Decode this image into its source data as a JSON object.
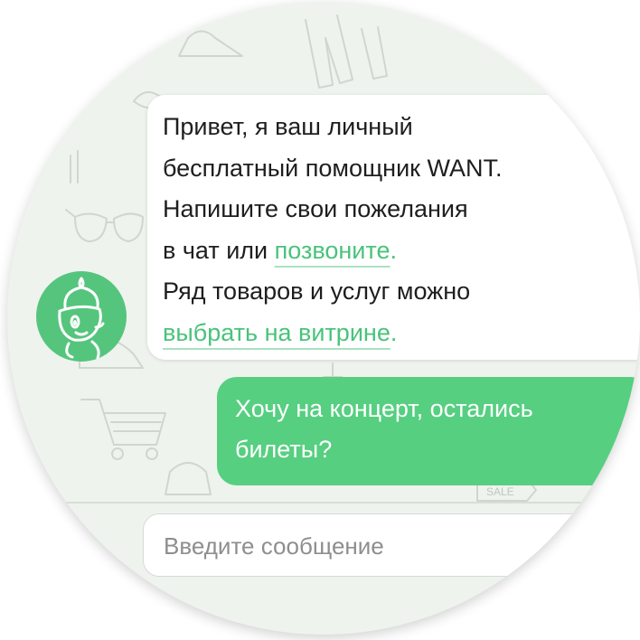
{
  "chat": {
    "bot_message": {
      "line1": "Привет, я ваш личный",
      "line2": "бесплатный помощник WANT.",
      "line3": "Напишите свои пожелания",
      "line4_prefix": "в чат или ",
      "line4_link": "позвоните",
      "line4_suffix": ".",
      "line5": "Ряд товаров и услуг можно",
      "line6_link": "выбрать на витрине",
      "line6_suffix": "."
    },
    "user_message": {
      "line1": "Хочу на концерт, остались",
      "line2": "билеты?"
    }
  },
  "input": {
    "placeholder": "Введите сообщение"
  },
  "doodles": {
    "sale_tag": "SALE"
  },
  "colors": {
    "accent_green": "#55c57d",
    "user_bubble": "#56cf80",
    "link": "#49c37a",
    "background": "#eef3ee"
  },
  "icons": {
    "avatar": "genie-mascot-icon"
  }
}
